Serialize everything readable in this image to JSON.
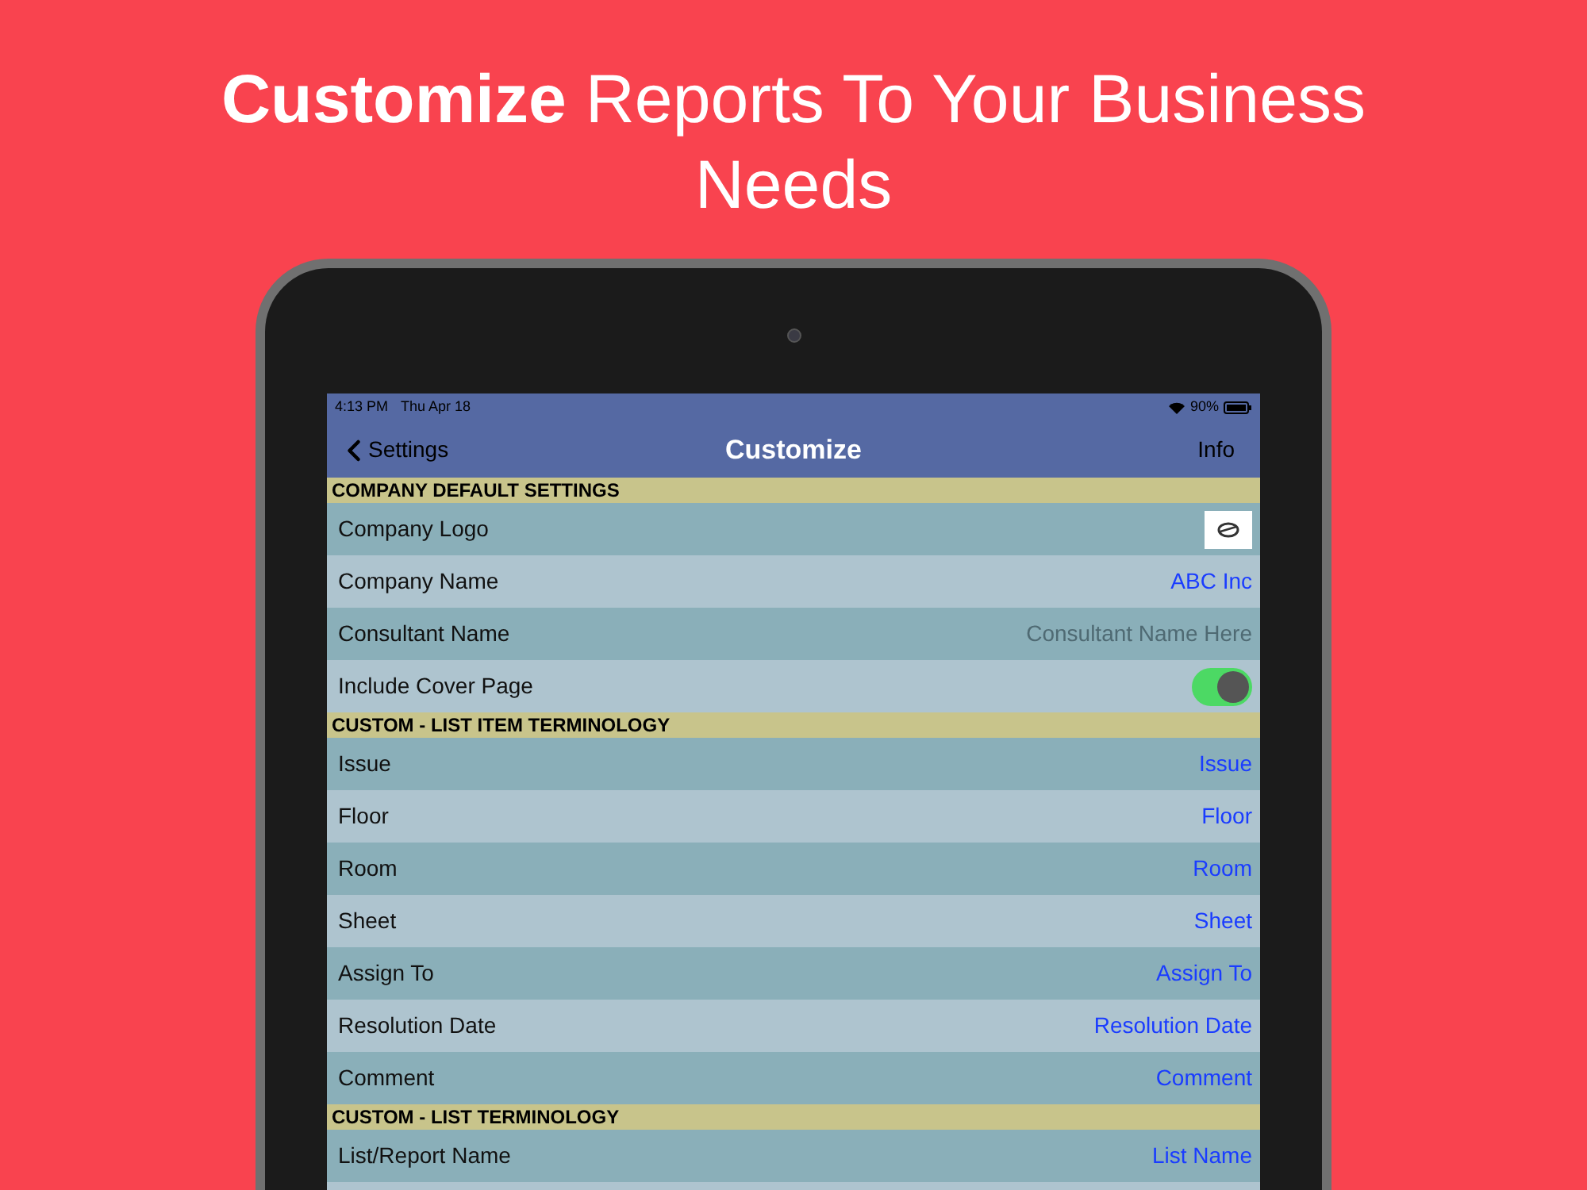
{
  "headline": "**Customize** Reports To Your Business Needs",
  "status_bar": {
    "time": "4:13 PM",
    "date": "Thu Apr 18",
    "battery": "90%"
  },
  "nav": {
    "back": "Settings",
    "title": "Customize",
    "action": "Info"
  },
  "sections": [
    {
      "header": "COMPANY DEFAULT SETTINGS",
      "rows": [
        {
          "kind": "image",
          "label": "Company Logo"
        },
        {
          "kind": "value",
          "label": "Company Name",
          "value": "ABC Inc"
        },
        {
          "kind": "placeholder",
          "label": "Consultant Name",
          "placeholder": "Consultant Name Here"
        },
        {
          "kind": "toggle",
          "label": "Include Cover Page",
          "on": true
        }
      ]
    },
    {
      "header": "CUSTOM - LIST ITEM TERMINOLOGY",
      "rows": [
        {
          "kind": "value",
          "label": "Issue",
          "value": "Issue"
        },
        {
          "kind": "value",
          "label": "Floor",
          "value": "Floor"
        },
        {
          "kind": "value",
          "label": "Room",
          "value": "Room"
        },
        {
          "kind": "value",
          "label": "Sheet",
          "value": "Sheet"
        },
        {
          "kind": "value",
          "label": "Assign To",
          "value": "Assign To"
        },
        {
          "kind": "value",
          "label": "Resolution Date",
          "value": "Resolution Date"
        },
        {
          "kind": "value",
          "label": "Comment",
          "value": "Comment"
        }
      ]
    },
    {
      "header": "CUSTOM - LIST TERMINOLOGY",
      "rows": [
        {
          "kind": "value",
          "label": "List/Report Name",
          "value": "List Name"
        }
      ]
    }
  ]
}
